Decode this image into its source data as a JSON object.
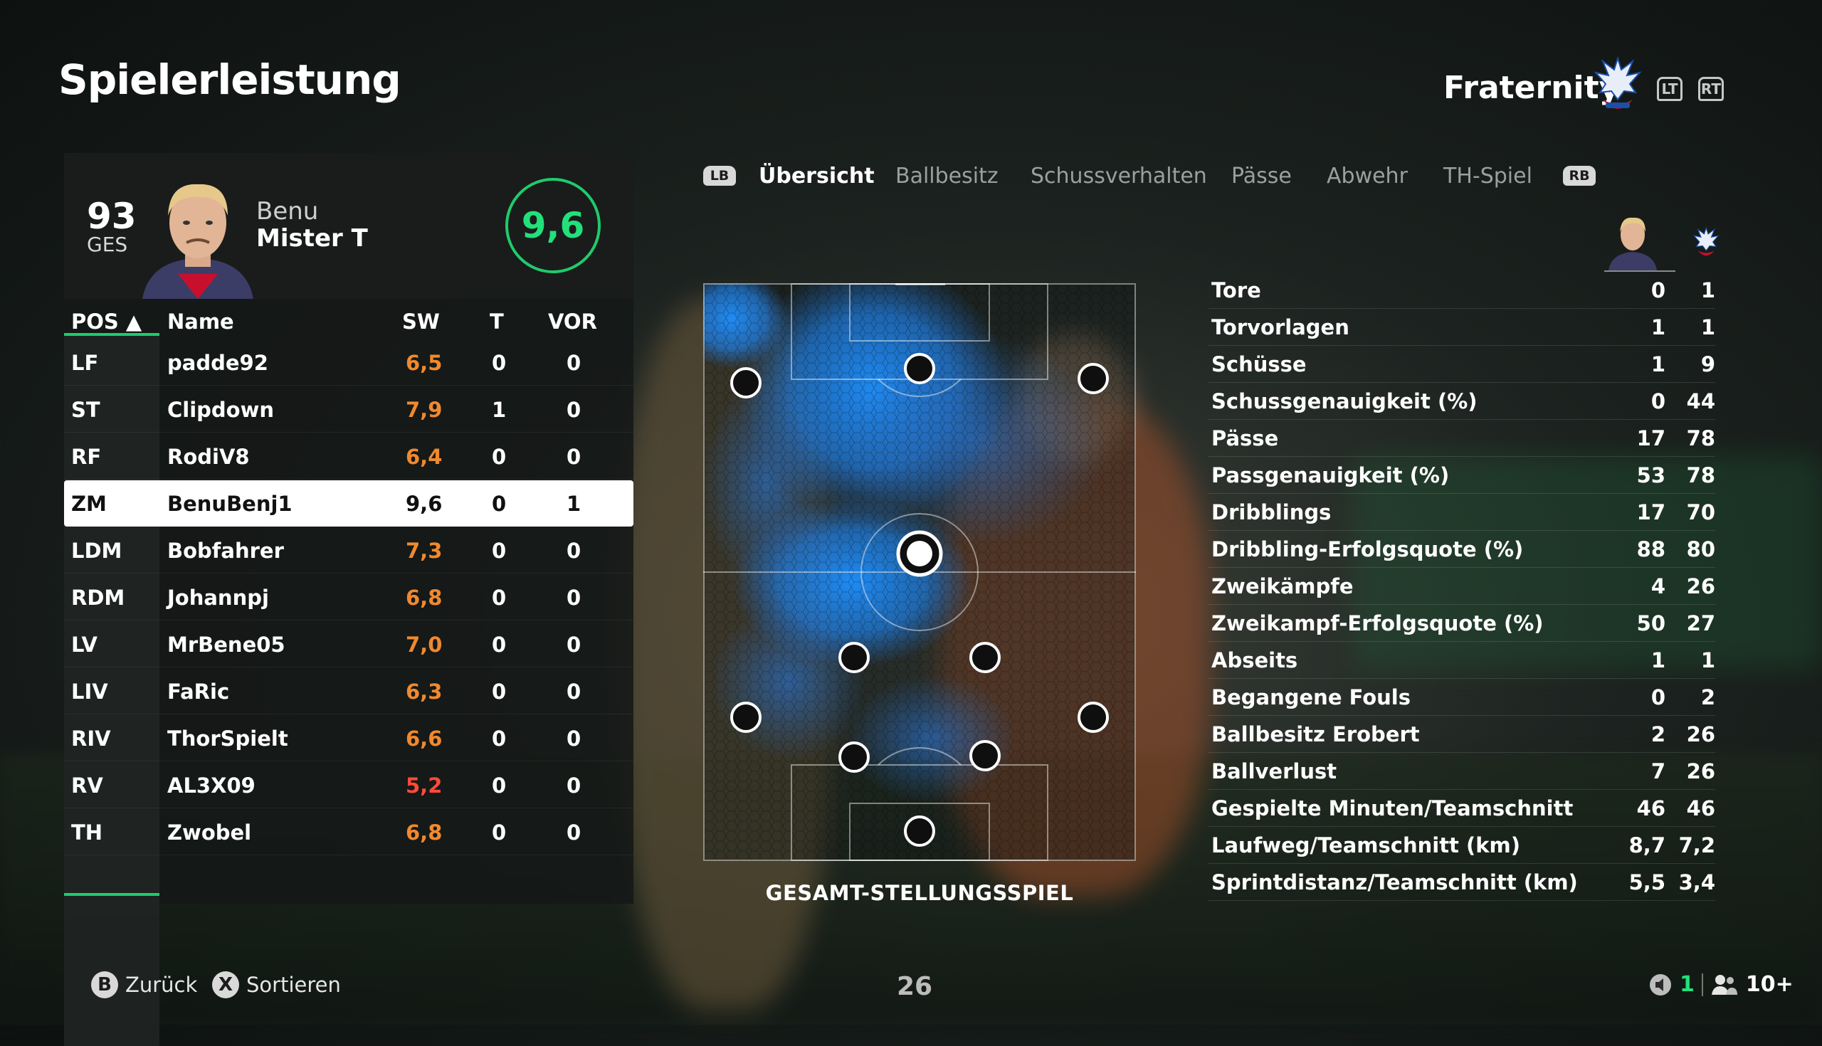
{
  "header": {
    "title": "Spielerleistung",
    "team_name": "Fraternity",
    "lt": "LT",
    "rt": "RT"
  },
  "player": {
    "overall": "93",
    "overall_label": "GES",
    "first_name": "Benu",
    "last_name": "Mister T",
    "rating": "9,6"
  },
  "table": {
    "headers": {
      "pos": "POS ▲",
      "name": "Name",
      "sw": "SW",
      "t": "T",
      "vor": "VOR"
    },
    "rows": [
      {
        "pos": "LF",
        "name": "padde92",
        "sw": "6,5",
        "t": "0",
        "vor": "0",
        "selected": false
      },
      {
        "pos": "ST",
        "name": "Clipdown",
        "sw": "7,9",
        "t": "1",
        "vor": "0",
        "selected": false
      },
      {
        "pos": "RF",
        "name": "RodiV8",
        "sw": "6,4",
        "t": "0",
        "vor": "0",
        "selected": false
      },
      {
        "pos": "ZM",
        "name": "BenuBenj1",
        "sw": "9,6",
        "t": "0",
        "vor": "1",
        "selected": true
      },
      {
        "pos": "LDM",
        "name": "Bobfahrer",
        "sw": "7,3",
        "t": "0",
        "vor": "0",
        "selected": false
      },
      {
        "pos": "RDM",
        "name": "Johannpj",
        "sw": "6,8",
        "t": "0",
        "vor": "0",
        "selected": false
      },
      {
        "pos": "LV",
        "name": "MrBene05",
        "sw": "7,0",
        "t": "0",
        "vor": "0",
        "selected": false
      },
      {
        "pos": "LIV",
        "name": "FaRic",
        "sw": "6,3",
        "t": "0",
        "vor": "0",
        "selected": false
      },
      {
        "pos": "RIV",
        "name": "ThorSpielt",
        "sw": "6,6",
        "t": "0",
        "vor": "0",
        "selected": false
      },
      {
        "pos": "RV",
        "name": "AL3X09",
        "sw": "5,2",
        "t": "0",
        "vor": "0",
        "selected": false
      },
      {
        "pos": "TH",
        "name": "Zwobel",
        "sw": "6,8",
        "t": "0",
        "vor": "0",
        "selected": false
      }
    ]
  },
  "tabs": {
    "lb": "LB",
    "rb": "RB",
    "items": [
      "Übersicht",
      "Ballbesitz",
      "Schussverhalten",
      "Pässe",
      "Abwehr",
      "TH-Spiel"
    ],
    "active_index": 0
  },
  "pitch": {
    "caption": "GESAMT-STELLUNGSSPIEL"
  },
  "stats": [
    {
      "label": "Tore",
      "player": "0",
      "team": "1"
    },
    {
      "label": "Torvorlagen",
      "player": "1",
      "team": "1"
    },
    {
      "label": "Schüsse",
      "player": "1",
      "team": "9"
    },
    {
      "label": "Schussgenauigkeit (%)",
      "player": "0",
      "team": "44"
    },
    {
      "label": "Pässe",
      "player": "17",
      "team": "78"
    },
    {
      "label": "Passgenauigkeit (%)",
      "player": "53",
      "team": "78"
    },
    {
      "label": "Dribblings",
      "player": "17",
      "team": "70"
    },
    {
      "label": "Dribbling-Erfolgsquote (%)",
      "player": "88",
      "team": "80"
    },
    {
      "label": "Zweikämpfe",
      "player": "4",
      "team": "26"
    },
    {
      "label": "Zweikampf-Erfolgsquote (%)",
      "player": "50",
      "team": "27"
    },
    {
      "label": "Abseits",
      "player": "1",
      "team": "1"
    },
    {
      "label": "Begangene Fouls",
      "player": "0",
      "team": "2"
    },
    {
      "label": "Ballbesitz Erobert",
      "player": "2",
      "team": "26"
    },
    {
      "label": "Ballverlust",
      "player": "7",
      "team": "26"
    },
    {
      "label": "Gespielte Minuten/Teamschnitt",
      "player": "46",
      "team": "46"
    },
    {
      "label": "Laufweg/Teamschnitt (km)",
      "player": "8,7",
      "team": "7,2"
    },
    {
      "label": "Sprintdistanz/Teamschnitt (km)",
      "player": "5,5",
      "team": "3,4"
    }
  ],
  "footer": {
    "back_key": "B",
    "back_label": "Zurück",
    "sort_key": "X",
    "sort_label": "Sortieren",
    "page": "26",
    "mic_count": "1",
    "party_count": "10+"
  },
  "colors": {
    "accent_green": "#22e07a",
    "rating_orange": "#f0892e",
    "heat_blue": "#1e90ff"
  },
  "icons": [
    "crest-icon",
    "lt-trigger-icon",
    "rt-trigger-icon",
    "lb-bumper-icon",
    "rb-bumper-icon",
    "b-button-icon",
    "x-button-icon",
    "mic-muted-icon",
    "party-icon"
  ]
}
